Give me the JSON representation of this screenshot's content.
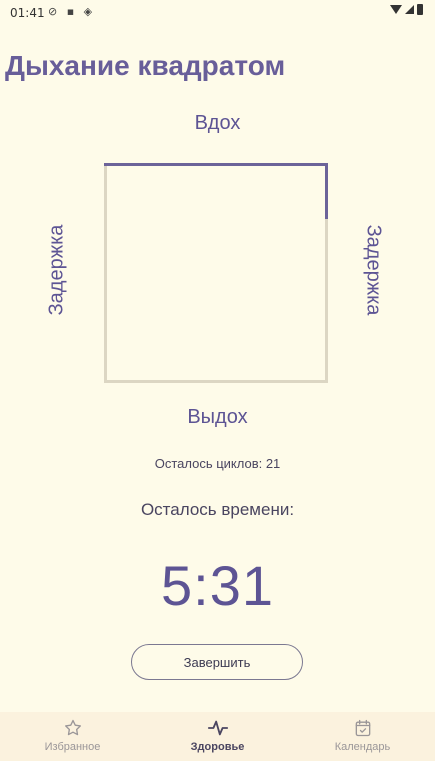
{
  "status_bar": {
    "time": "01:41"
  },
  "title": "Дыхание квадратом",
  "square": {
    "top_label": "Вдох",
    "bottom_label": "Выдох",
    "left_label": "Задержка",
    "right_label": "Задержка"
  },
  "cycles_text": "Осталось циклов: 21",
  "time_label": "Осталось времени:",
  "timer": "5:31",
  "finish_button": "Завершить",
  "nav": [
    {
      "label": "Избранное",
      "icon": "star-icon"
    },
    {
      "label": "Здоровье",
      "icon": "heartbeat-icon"
    },
    {
      "label": "Календарь",
      "icon": "calendar-check-icon"
    }
  ],
  "colors": {
    "accent": "#685e99",
    "background": "#fefbe9",
    "square_track": "#dcd6c3"
  }
}
